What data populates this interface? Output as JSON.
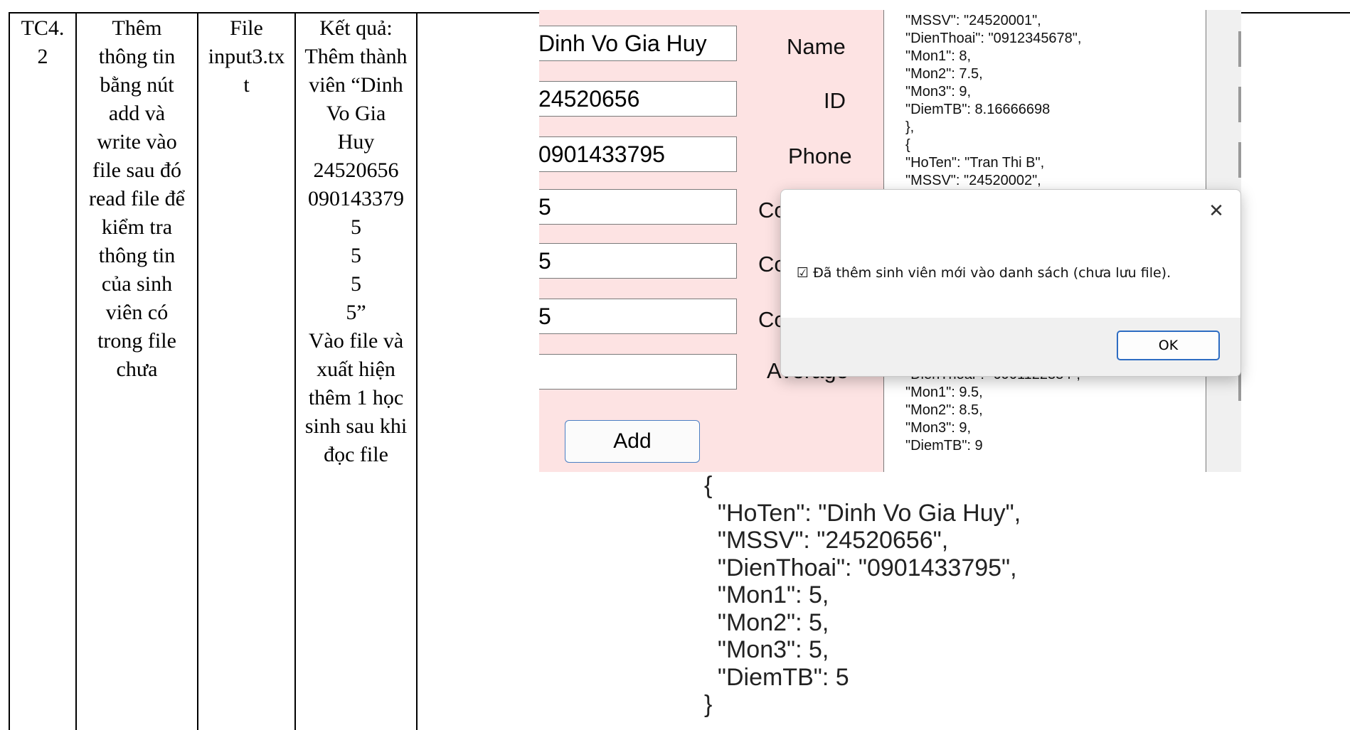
{
  "table": {
    "id_lines": [
      "TC4.",
      "2"
    ],
    "description_lines": [
      "Thêm",
      "thông tin",
      "bằng nút",
      "add và",
      "write vào",
      "file sau đó",
      "read file để",
      "kiểm tra",
      "thông tin",
      "của sinh",
      "viên có",
      "trong file",
      "chưa"
    ],
    "input_lines": [
      "File",
      "input3.tx",
      "t"
    ],
    "result_lines": [
      "Kết quả:",
      "Thêm thành",
      "viên “Dinh",
      "Vo Gia",
      "Huy",
      "24520656",
      "090143379",
      "5",
      "5",
      "5",
      "5”",
      "Vào file và",
      "xuất hiện",
      "thêm 1 học",
      "sinh sau khi",
      "đọc file"
    ]
  },
  "app": {
    "fields": [
      {
        "value": "Dinh Vo Gia Huy",
        "label": "Name"
      },
      {
        "value": "24520656",
        "label": "ID"
      },
      {
        "value": "0901433795",
        "label": "Phone"
      },
      {
        "value": "5",
        "label": "Co"
      },
      {
        "value": "5",
        "label": "Co"
      },
      {
        "value": "5",
        "label": "Co"
      },
      {
        "value": "",
        "label": "Average"
      }
    ],
    "add_button": "Add",
    "listbox_top": [
      "\"MSSV\": \"24520001\",",
      "\"DienThoai\": \"0912345678\",",
      "\"Mon1\": 8,",
      "\"Mon2\": 7.5,",
      "\"Mon3\": 9,",
      "\"DiemTB\": 8.16666698",
      "},",
      "{",
      "\"HoTen\": \"Tran Thi B\",",
      "\"MSSV\": \"24520002\","
    ],
    "listbox_bottom": [
      "\"DienThoai\": \"0901122334\",",
      "\"Mon1\": 9.5,",
      "\"Mon2\": 8.5,",
      "\"Mon3\": 9,",
      "\"DiemTB\": 9"
    ]
  },
  "dialog": {
    "message": "☑ Đã thêm sinh viên mới vào danh sách (chưa lưu file).",
    "close_glyph": "✕",
    "ok_label": "OK"
  },
  "json_output": {
    "lines": [
      "{",
      "  \"HoTen\": \"Dinh Vo Gia Huy\",",
      "  \"MSSV\": \"24520656\",",
      "  \"DienThoai\": \"0901433795\",",
      "  \"Mon1\": 5,",
      "  \"Mon2\": 5,",
      "  \"Mon3\": 5,",
      "  \"DiemTB\": 5",
      "}"
    ]
  }
}
